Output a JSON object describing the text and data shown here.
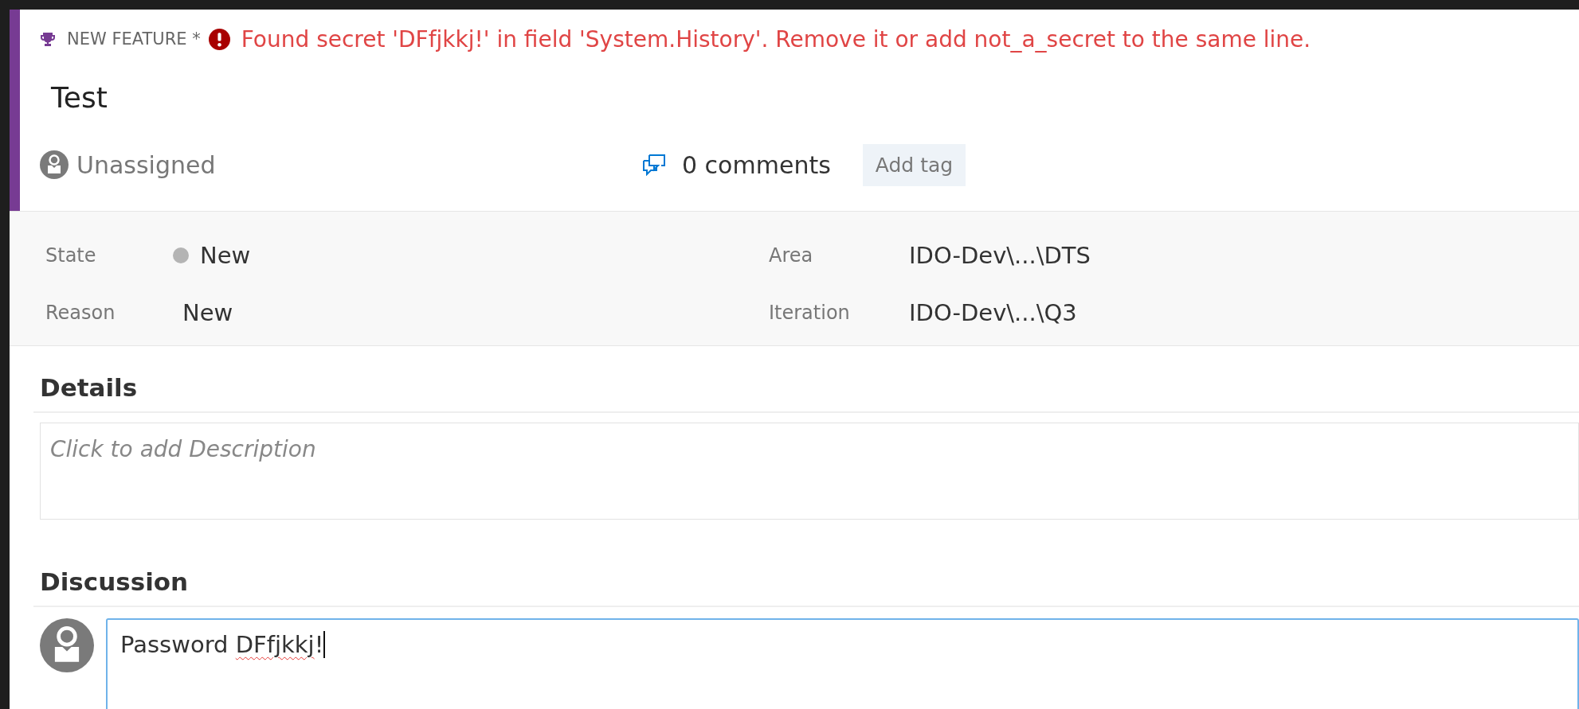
{
  "work_item": {
    "type": "NEW FEATURE *",
    "error": "Found secret 'DFfjkkj!' in field 'System.History'. Remove it or add not_a_secret to the same line.",
    "title": "Test",
    "assignee": "Unassigned",
    "comments": "0 comments",
    "add_tag": "Add tag"
  },
  "fields": [
    {
      "kind": "state",
      "label": "State",
      "value": "New",
      "color": "#b4b4b4"
    },
    {
      "kind": "text",
      "label": "Area",
      "value": "IDO-Dev\\...\\DTS"
    },
    {
      "kind": "text",
      "label": "Reason",
      "value": "New"
    },
    {
      "kind": "text",
      "label": "Iteration",
      "value": "IDO-Dev\\...\\Q3"
    }
  ],
  "details": {
    "heading": "Details",
    "placeholder": "Click to add Description"
  },
  "discussion": {
    "heading": "Discussion",
    "focused": true,
    "value_parts": [
      {
        "text": "Password ",
        "misspelled": false
      },
      {
        "text": "DFfjkkj",
        "misspelled": true
      },
      {
        "text": "!",
        "misspelled": false
      }
    ]
  }
}
